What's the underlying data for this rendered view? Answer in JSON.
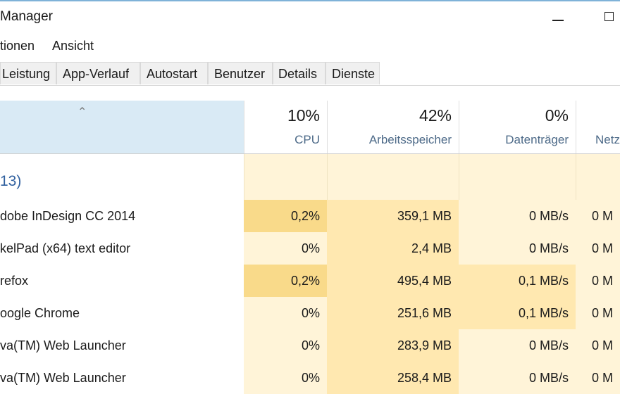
{
  "window": {
    "title": "Manager"
  },
  "menu": [
    "tionen",
    "Ansicht"
  ],
  "tabs": [
    "Leistung",
    "App-Verlauf",
    "Autostart",
    "Benutzer",
    "Details",
    "Dienste"
  ],
  "columns": [
    {
      "percent": "10%",
      "label": "CPU"
    },
    {
      "percent": "42%",
      "label": "Arbeitsspeicher"
    },
    {
      "percent": "0%",
      "label": "Datenträger"
    },
    {
      "percent": "",
      "label": "Netz"
    }
  ],
  "group": {
    "label": "13)"
  },
  "processes": [
    {
      "name": "dobe InDesign CC 2014",
      "cpu": "0,2%",
      "memory": "359,1 MB",
      "disk": "0 MB/s",
      "net": "0 M"
    },
    {
      "name": "kelPad (x64) text editor",
      "cpu": "0%",
      "memory": "2,4 MB",
      "disk": "0 MB/s",
      "net": "0 M"
    },
    {
      "name": "refox",
      "cpu": "0,2%",
      "memory": "495,4 MB",
      "disk": "0,1 MB/s",
      "net": "0 M"
    },
    {
      "name": "oogle Chrome",
      "cpu": "0%",
      "memory": "251,6 MB",
      "disk": "0,1 MB/s",
      "net": "0 M"
    },
    {
      "name": "va(TM) Web Launcher",
      "cpu": "0%",
      "memory": "283,9 MB",
      "disk": "0 MB/s",
      "net": "0 M"
    },
    {
      "name": "va(TM) Web Launcher",
      "cpu": "0%",
      "memory": "258,4 MB",
      "disk": "0 MB/s",
      "net": "0 M"
    }
  ],
  "colors": {
    "heat_light": "#fff4d8",
    "heat_mid": "#ffe8b0",
    "heat_strong": "#f9da8a",
    "accent": "#2f5f9e",
    "header_selected": "#d9eaf5"
  }
}
